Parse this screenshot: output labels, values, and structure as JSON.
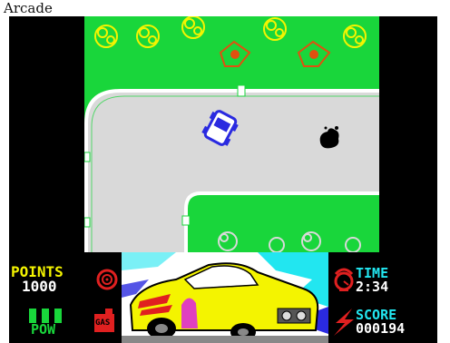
{
  "window": {
    "title": "Arcade"
  },
  "hud": {
    "points_label": "POINTS",
    "points_value": "1000",
    "time_label": "TIME",
    "time_value": "2:34",
    "score_label": "SCORE",
    "score_value": "000194",
    "pow_label": "POW",
    "gas_label": "GAS",
    "pow_level": 1.0
  },
  "colors": {
    "grass": "#19d63b",
    "road": "#d9d9d9",
    "kerb": "#ffffff",
    "hud_yellow": "#f4f400",
    "hud_cyan": "#22e6f0",
    "hud_red": "#e02020",
    "player_car": "#2a2ae0",
    "enemy": "#000000"
  },
  "icons": {
    "points": "target-icon",
    "time": "stopwatch-icon",
    "score": "lightning-bolt-icon",
    "gas": "fuel-can-icon",
    "pow": "power-bars-icon"
  }
}
